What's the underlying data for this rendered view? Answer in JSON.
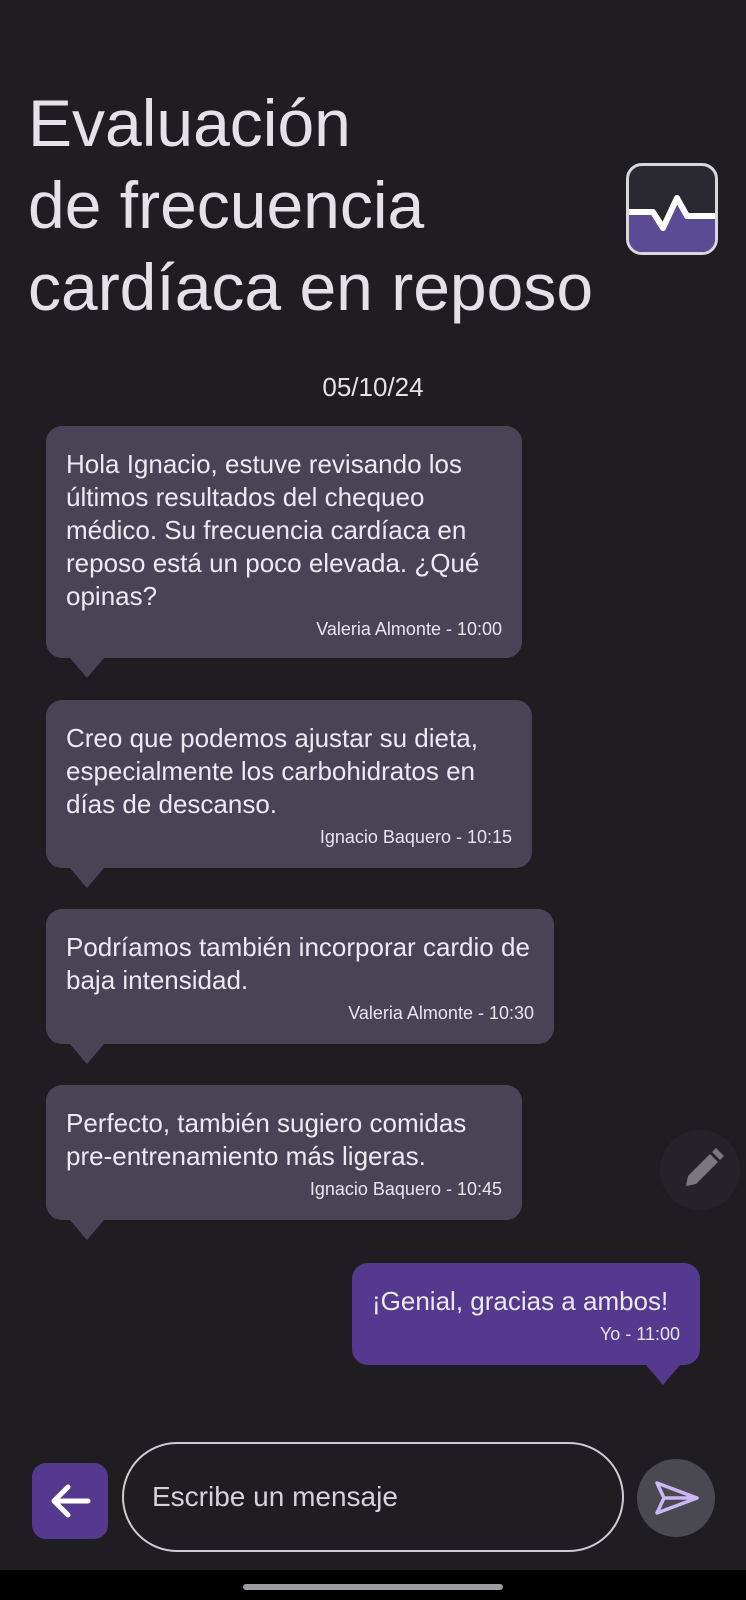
{
  "header": {
    "title_lines": [
      "Evaluación",
      "de frecuencia",
      "cardíaca en reposo"
    ],
    "icon": "heart-rate-icon"
  },
  "date": "05/10/24",
  "messages": [
    {
      "text": "Hola Ignacio, estuve revisando los últimos resultados del chequeo médico. Su frecuencia cardíaca en reposo está un poco elevada. ¿Qué opinas?",
      "meta": "Valeria Almonte - 10:00",
      "outgoing": false
    },
    {
      "text": "Creo que podemos ajustar su dieta, especialmente los carbohidratos en días de descanso.",
      "meta": "Ignacio Baquero - 10:15",
      "outgoing": false
    },
    {
      "text": "Podríamos también incorporar cardio de baja intensidad.",
      "meta": "Valeria Almonte - 10:30",
      "outgoing": false
    },
    {
      "text": "Perfecto, también sugiero comidas pre-entrenamiento más ligeras.",
      "meta": "Ignacio Baquero - 10:45",
      "outgoing": false
    },
    {
      "text": "¡Genial, gracias a ambos!",
      "meta": "Yo - 11:00",
      "outgoing": true
    }
  ],
  "composer": {
    "placeholder": "Escribe un mensaje",
    "back_icon": "arrow-left-icon",
    "send_icon": "send-icon",
    "edit_icon": "pencil-icon"
  },
  "colors": {
    "background": "#1f1d22",
    "incoming_bubble": "#4a4356",
    "outgoing_bubble": "#55398e",
    "accent": "#55398e"
  }
}
